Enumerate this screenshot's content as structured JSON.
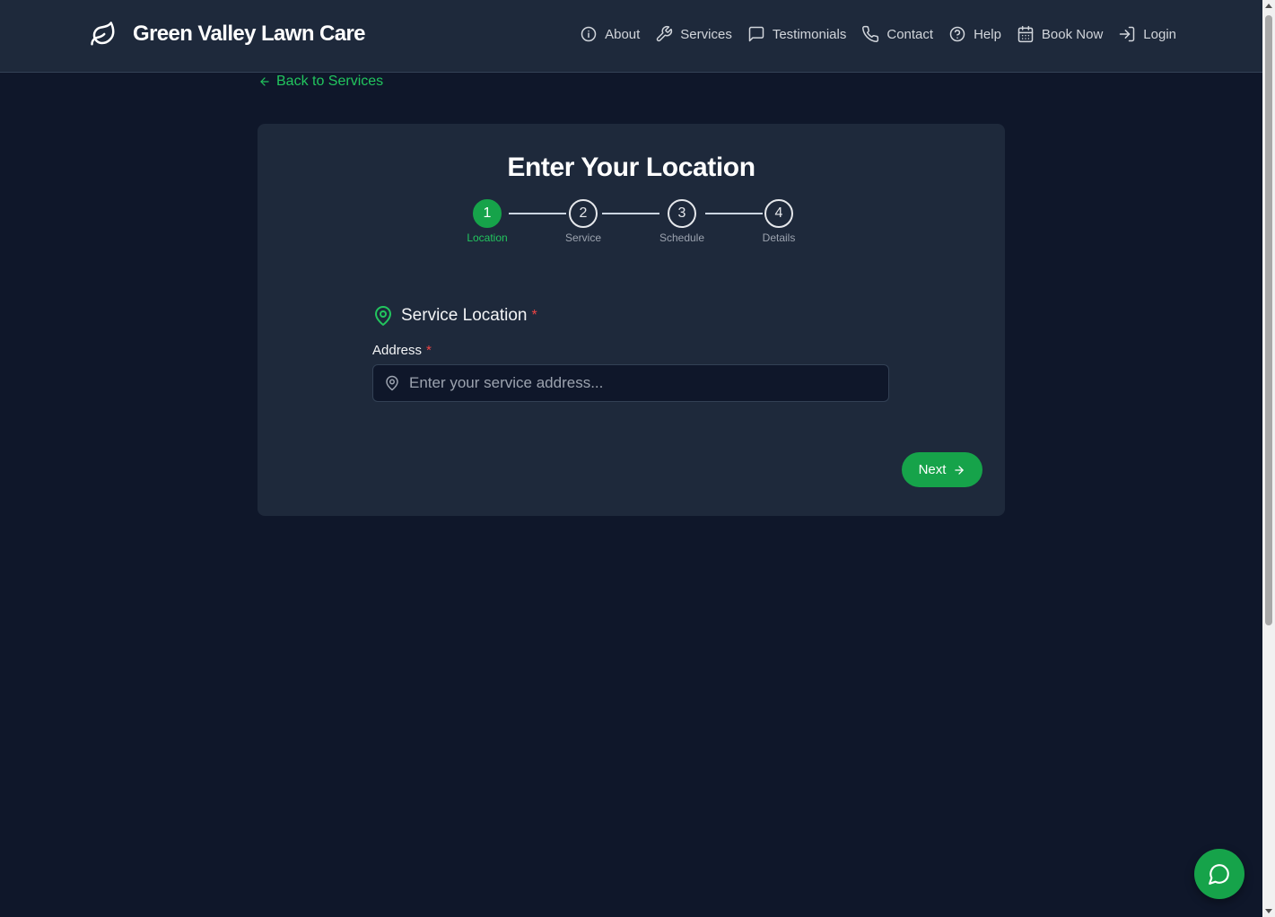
{
  "header": {
    "brand_name": "Green Valley Lawn Care",
    "logo_icon": "leaf-icon",
    "nav": [
      {
        "label": "About",
        "icon": "info-icon"
      },
      {
        "label": "Services",
        "icon": "wrench-icon"
      },
      {
        "label": "Testimonials",
        "icon": "message-square-icon"
      },
      {
        "label": "Contact",
        "icon": "phone-icon"
      },
      {
        "label": "Help",
        "icon": "help-circle-icon"
      },
      {
        "label": "Book Now",
        "icon": "calendar-icon"
      },
      {
        "label": "Login",
        "icon": "login-icon"
      }
    ]
  },
  "back_link": {
    "label": "Back to Services",
    "icon": "arrow-left-icon"
  },
  "card": {
    "title": "Enter Your Location",
    "steps": [
      {
        "number": "1",
        "label": "Location",
        "active": true
      },
      {
        "number": "2",
        "label": "Service",
        "active": false
      },
      {
        "number": "3",
        "label": "Schedule",
        "active": false
      },
      {
        "number": "4",
        "label": "Details",
        "active": false
      }
    ],
    "section": {
      "title": "Service Location",
      "required_mark": "*",
      "icon": "map-pin-icon"
    },
    "address": {
      "label": "Address",
      "required_mark": "*",
      "value": "",
      "placeholder": "Enter your service address...",
      "icon": "map-pin-icon"
    },
    "next_button": {
      "label": "Next",
      "icon": "arrow-right-icon"
    }
  },
  "chat_fab": {
    "icon": "chat-bubble-icon"
  },
  "colors": {
    "background": "#0f172a",
    "header": "#1e293b",
    "card": "#1e293b",
    "accent": "#16a34a",
    "accent_text": "#22c55e",
    "required": "#ef4444"
  }
}
